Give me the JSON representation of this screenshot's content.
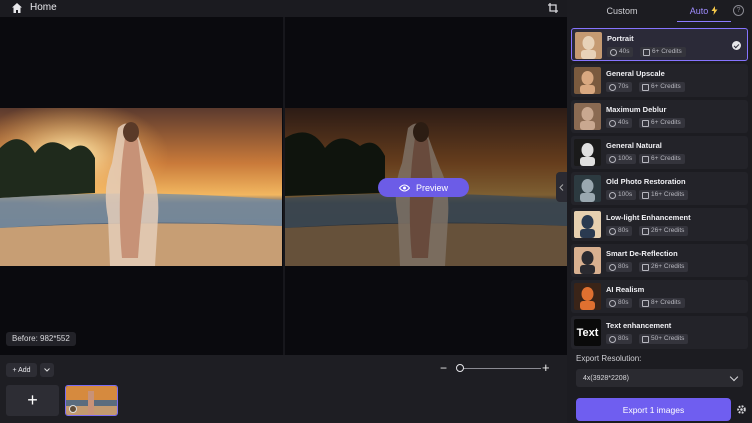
{
  "header": {
    "home_label": "Home"
  },
  "tabs": {
    "custom": "Custom",
    "auto": "Auto"
  },
  "preview_label": "Preview",
  "before_label": "Before: 982*552",
  "toolbar": {
    "add_label": "+ Add"
  },
  "models": [
    {
      "name": "Portrait",
      "time": "40s",
      "credits": "6+ Credits",
      "selected": true
    },
    {
      "name": "General Upscale",
      "time": "70s",
      "credits": "6+ Credits"
    },
    {
      "name": "Maximum Deblur",
      "time": "40s",
      "credits": "6+ Credits"
    },
    {
      "name": "General Natural",
      "time": "100s",
      "credits": "6+ Credits"
    },
    {
      "name": "Old Photo Restoration",
      "time": "100s",
      "credits": "16+ Credits"
    },
    {
      "name": "Low-light Enhancement",
      "time": "80s",
      "credits": "26+ Credits"
    },
    {
      "name": "Smart De-Reflection",
      "time": "80s",
      "credits": "26+ Credits"
    },
    {
      "name": "AI Realism",
      "time": "80s",
      "credits": "8+ Credits"
    },
    {
      "name": "Text enhancement",
      "time": "80s",
      "credits": "50+ Credits",
      "thumb_text": "Text"
    }
  ],
  "export": {
    "label": "Export Resolution:",
    "resolution": "4x(3928*2208)",
    "button": "Export 1 images"
  },
  "colors": {
    "accent": "#6f5ef0",
    "panel": "#1c1c21",
    "canvas": "#0a0a0e"
  }
}
